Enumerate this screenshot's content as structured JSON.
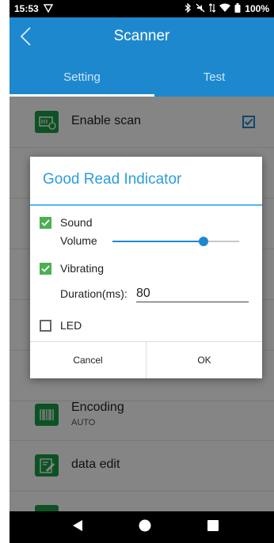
{
  "status_bar": {
    "time": "15:53",
    "battery": "100%"
  },
  "app_bar": {
    "title": "Scanner"
  },
  "tabs": [
    {
      "label": "Setting"
    },
    {
      "label": "Test"
    }
  ],
  "list": {
    "enable_scan": {
      "label": "Enable scan",
      "checked": true
    },
    "encoding": {
      "label": "Encoding",
      "value": "AUTO"
    },
    "data_edit": {
      "label": "data edit"
    }
  },
  "dialog": {
    "title": "Good Read Indicator",
    "sound": {
      "label": "Sound",
      "checked": true
    },
    "volume": {
      "label": "Volume",
      "level": 0.72
    },
    "vibrating": {
      "label": "Vibrating",
      "checked": true
    },
    "duration": {
      "label": "Duration(ms):",
      "value": "80"
    },
    "led": {
      "label": "LED",
      "checked": false
    },
    "cancel_label": "Cancel",
    "ok_label": "OK"
  },
  "colors": {
    "accent": "#1e88cf",
    "dialog_title": "#2d9ddc",
    "checkbox": "#4caf50",
    "icon": "#1a9e45"
  }
}
